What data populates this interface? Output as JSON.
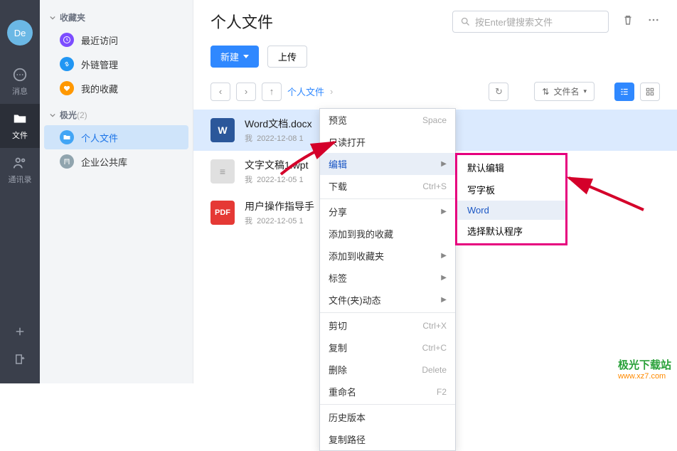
{
  "nav": {
    "avatar_text": "De",
    "items": [
      {
        "label": "消息"
      },
      {
        "label": "文件"
      },
      {
        "label": "通讯录"
      }
    ]
  },
  "sidebar": {
    "fav_section": "收藏夹",
    "items_fav": [
      {
        "label": "最近访问"
      },
      {
        "label": "外链管理"
      },
      {
        "label": "我的收藏"
      }
    ],
    "jg_section": "极光",
    "jg_count": "(2)",
    "items_jg": [
      {
        "label": "个人文件"
      },
      {
        "label": "企业公共库"
      }
    ]
  },
  "header": {
    "title": "个人文件",
    "search_placeholder": "按Enter键搜索文件"
  },
  "toolbar": {
    "new_label": "新建",
    "upload_label": "上传"
  },
  "pathbar": {
    "crumb": "个人文件",
    "sort_label": "文件名"
  },
  "files": [
    {
      "name": "Word文档.docx",
      "owner": "我",
      "date": "2022-12-08 1",
      "type": "word"
    },
    {
      "name": "文字文稿1.wpt",
      "owner": "我",
      "date": "2022-12-05 1",
      "type": "wpt"
    },
    {
      "name": "用户操作指导手",
      "owner": "我",
      "date": "2022-12-05 1",
      "type": "pdf"
    }
  ],
  "context_menu": [
    {
      "label": "预览",
      "shortcut": "Space"
    },
    {
      "label": "只读打开"
    },
    {
      "label": "编辑",
      "submenu": true,
      "hover": true
    },
    {
      "label": "下载",
      "shortcut": "Ctrl+S"
    },
    {
      "sep": true
    },
    {
      "label": "分享",
      "submenu": true
    },
    {
      "label": "添加到我的收藏"
    },
    {
      "label": "添加到收藏夹",
      "submenu": true
    },
    {
      "label": "标签",
      "submenu": true
    },
    {
      "label": "文件(夹)动态",
      "submenu": true
    },
    {
      "sep": true
    },
    {
      "label": "剪切",
      "shortcut": "Ctrl+X"
    },
    {
      "label": "复制",
      "shortcut": "Ctrl+C"
    },
    {
      "label": "删除",
      "shortcut": "Delete"
    },
    {
      "label": "重命名",
      "shortcut": "F2"
    },
    {
      "sep": true
    },
    {
      "label": "历史版本"
    },
    {
      "label": "复制路径"
    }
  ],
  "submenu_edit": [
    {
      "label": "默认编辑"
    },
    {
      "label": "写字板"
    },
    {
      "label": "Word",
      "hover": true
    },
    {
      "label": "选择默认程序"
    }
  ],
  "watermark": {
    "top": "极光下载站",
    "bot": "www.xz7.com"
  }
}
